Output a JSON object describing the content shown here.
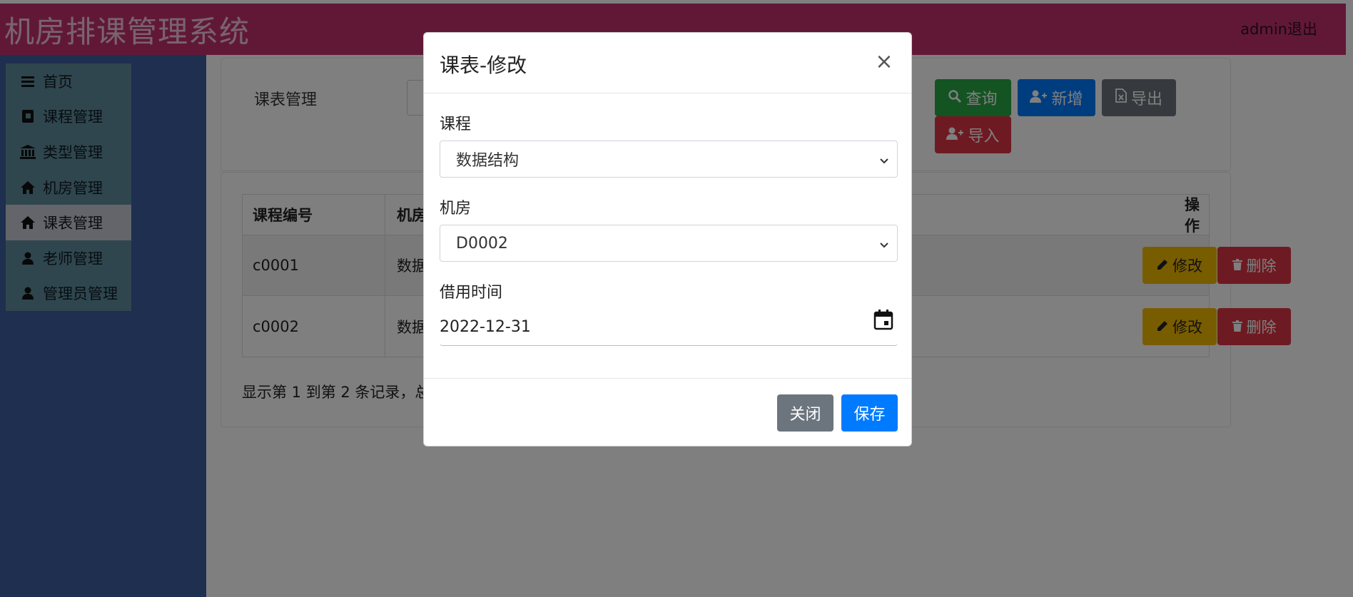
{
  "header": {
    "title": "机房排课管理系统",
    "user": "admin退出"
  },
  "sidebar": {
    "items": [
      {
        "label": "首页",
        "icon": "menu-icon"
      },
      {
        "label": "课程管理",
        "icon": "book-icon"
      },
      {
        "label": "类型管理",
        "icon": "bank-icon"
      },
      {
        "label": "机房管理",
        "icon": "home-icon"
      },
      {
        "label": "课表管理",
        "icon": "home-icon",
        "active": true
      },
      {
        "label": "老师管理",
        "icon": "user-icon"
      },
      {
        "label": "管理员管理",
        "icon": "user-icon"
      }
    ]
  },
  "search": {
    "label": "课表管理",
    "query": "查询",
    "add": "新增",
    "export": "导出",
    "import": "导入"
  },
  "table": {
    "headers": [
      "课程编号",
      "机房",
      "操作"
    ],
    "rows": [
      {
        "id": "c0001",
        "room": "数据"
      },
      {
        "id": "c0002",
        "room": "数据"
      }
    ],
    "edit_label": "修改",
    "delete_label": "删除",
    "pager": "显示第 1 到第 2 条记录，总"
  },
  "modal": {
    "title": "课表-修改",
    "close_symbol": "×",
    "course_label": "课程",
    "course_value": "数据结构",
    "room_label": "机房",
    "room_value": "D0002",
    "time_label": "借用时间",
    "time_value": "2022-12-31",
    "close_button": "关闭",
    "save_button": "保存"
  },
  "colors": {
    "header": "#c2306e",
    "sidebar": "#3d5f9e",
    "primary": "#007bff",
    "success": "#28a745",
    "danger": "#dc3545",
    "warning": "#f0b800",
    "secondary": "#6c757d"
  }
}
